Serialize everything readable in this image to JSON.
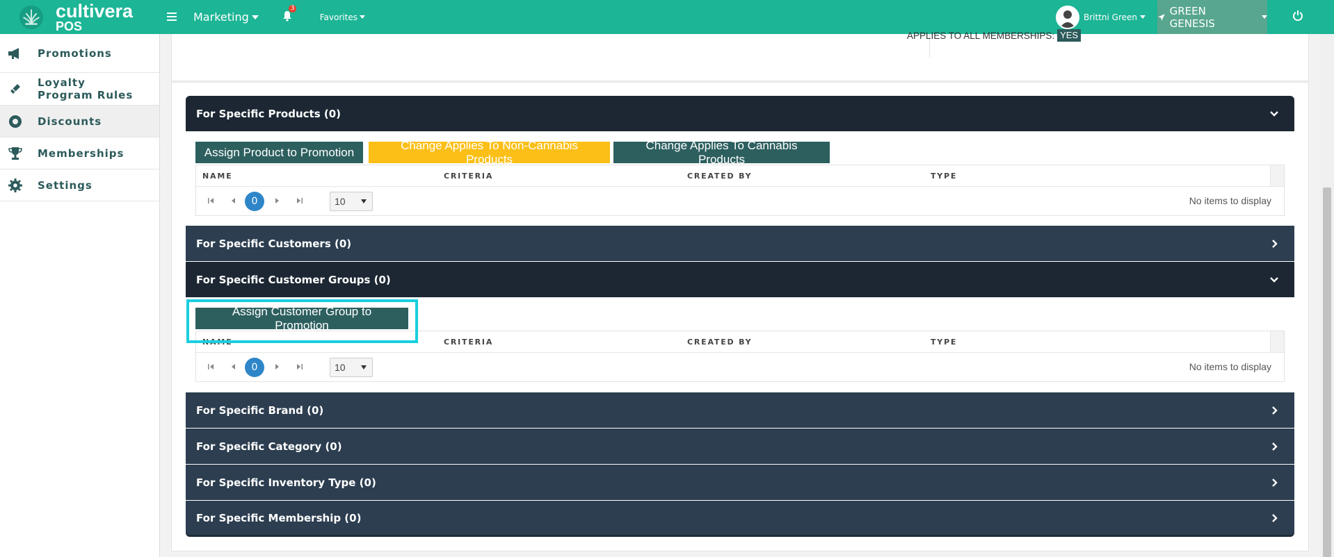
{
  "topbar": {
    "brand": "cultivera",
    "brand_sub": "POS",
    "module": "Marketing",
    "notifications_count": "3",
    "favorites": "Favorites",
    "user_name": "Brittni Green",
    "store_name": "GREEN GENESIS"
  },
  "sidebar": {
    "items": [
      {
        "label": "Promotions",
        "icon": "megaphone-icon"
      },
      {
        "label": "Loyalty Program Rules",
        "icon": "ticket-icon"
      },
      {
        "label": "Discounts",
        "icon": "badge-icon"
      },
      {
        "label": "Memberships",
        "icon": "trophy-icon"
      },
      {
        "label": "Settings",
        "icon": "gear-icon"
      }
    ]
  },
  "top_card": {
    "applies_label": "APPLIES TO ALL MEMBERSHIPS:",
    "applies_value": "YES"
  },
  "sections": [
    {
      "title": "For Specific Products (0)",
      "expanded": true
    },
    {
      "title": "For Specific Customers (0)",
      "expanded": false
    },
    {
      "title": "For Specific Customer Groups (0)",
      "expanded": true
    },
    {
      "title": "For Specific Brand (0)",
      "expanded": false
    },
    {
      "title": "For Specific Category (0)",
      "expanded": false
    },
    {
      "title": "For Specific Inventory Type (0)",
      "expanded": false
    },
    {
      "title": "For Specific Membership (0)",
      "expanded": false
    }
  ],
  "products_panel": {
    "buttons": {
      "assign": "Assign Product to Promotion",
      "non_cannabis": "Change Applies To Non-Cannabis Products",
      "cannabis": "Change Applies To Cannabis Products"
    }
  },
  "groups_panel": {
    "buttons": {
      "assign": "Assign Customer Group to Promotion"
    }
  },
  "grid": {
    "columns": [
      "NAME",
      "CRITERIA",
      "CREATED BY",
      "TYPE"
    ],
    "page": "0",
    "page_size": "10",
    "empty_text": "No items to display"
  },
  "colors": {
    "topbar": "#1cb596",
    "section_header": "#2c3e50",
    "section_header_open": "#1c2733",
    "teal_button": "#2d5f5f",
    "yellow_button": "#fbbf17",
    "focus_ring": "#18cfe0",
    "page_active": "#2e86c8"
  }
}
